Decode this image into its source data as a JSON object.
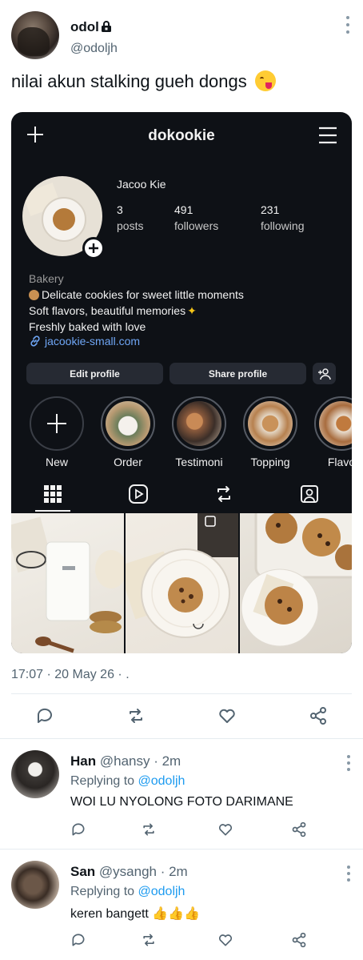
{
  "tweet": {
    "author_name": "odol",
    "author_handle": "@odoljh",
    "text": "nilai akun stalking gueh dongs",
    "time": "17:07 · 20 May 26 · ."
  },
  "instagram": {
    "username": "dokookie",
    "full_name": "Jacoo Kie",
    "stats": [
      {
        "value": "3",
        "label": "posts"
      },
      {
        "value": "491",
        "label": "followers"
      },
      {
        "value": "231",
        "label": "following"
      }
    ],
    "bio": {
      "category": "Bakery",
      "line1": "Delicate cookies for sweet little moments",
      "line2": "Soft flavors, beautiful memories",
      "line3": "Freshly baked with love"
    },
    "link": "jacookie-small.com",
    "buttons": {
      "edit": "Edit profile",
      "share": "Share profile"
    },
    "highlights": [
      "New",
      "Order",
      "Testimoni",
      "Topping",
      "Flavo"
    ]
  },
  "replies": [
    {
      "name": "Han",
      "handle": "@hansy · 2m",
      "replying_label": "Replying to",
      "replying_to": "@odoljh",
      "text": "WOI LU NYOLONG FOTO DARIMANE"
    },
    {
      "name": "San",
      "handle": "@ysangh · 2m",
      "replying_label": "Replying to",
      "replying_to": "@odoljh",
      "text": "keren bangett"
    }
  ]
}
